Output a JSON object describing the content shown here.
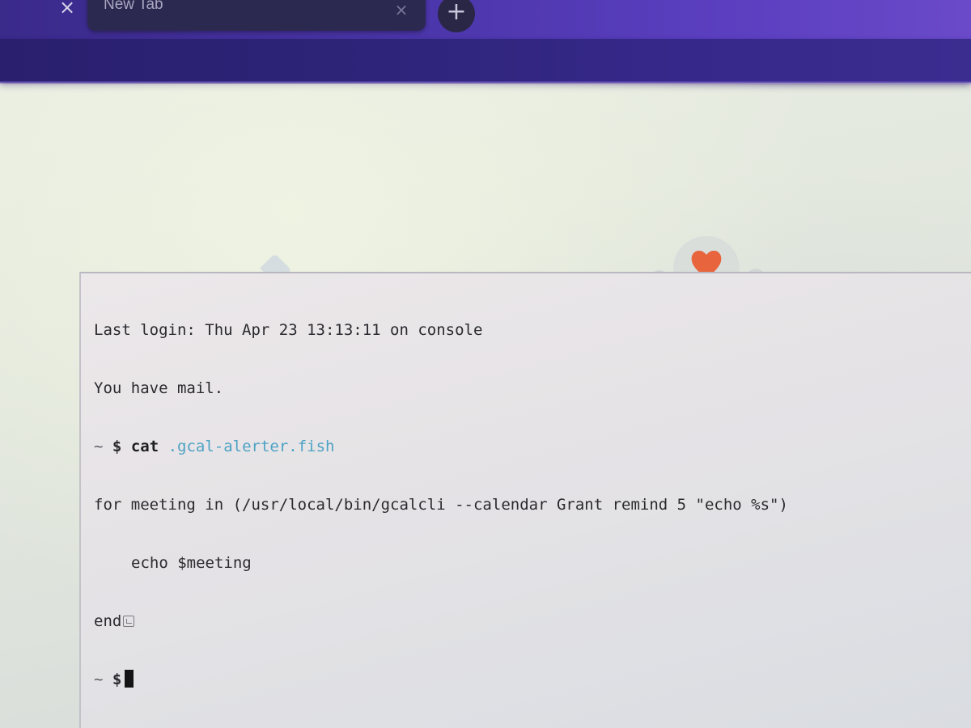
{
  "browser": {
    "tab": {
      "title": "New Tab",
      "close_glyph": "×"
    },
    "left_close_glyph": "×",
    "new_tab_glyph": "+",
    "icons": {
      "left_close": "close-icon",
      "tab_close": "close-icon",
      "new_tab": "plus-icon"
    },
    "colors": {
      "tabstrip": "#4a35a8",
      "toolbar": "#2d2478",
      "tab_background": "#2c2950"
    }
  },
  "wallpaper": {
    "icon": "heart-icon",
    "heart_color": "#e8643c"
  },
  "terminal": {
    "login_line": "Last login: Thu Apr 23 13:13:11 on console",
    "mail_line": "You have mail.",
    "prompt_tilde": "~",
    "prompt_symbol": "$",
    "command": "cat",
    "command_arg": ".gcal-alerter.fish",
    "output": {
      "line1": "for meeting in (/usr/local/bin/gcalcli --calendar Grant remind 5 \"echo %s\")",
      "line2": "echo $meeting",
      "line3": "end"
    },
    "colors": {
      "text": "#2a2a2e",
      "path_arg": "#4da3c4",
      "cursor": "#141416"
    }
  }
}
